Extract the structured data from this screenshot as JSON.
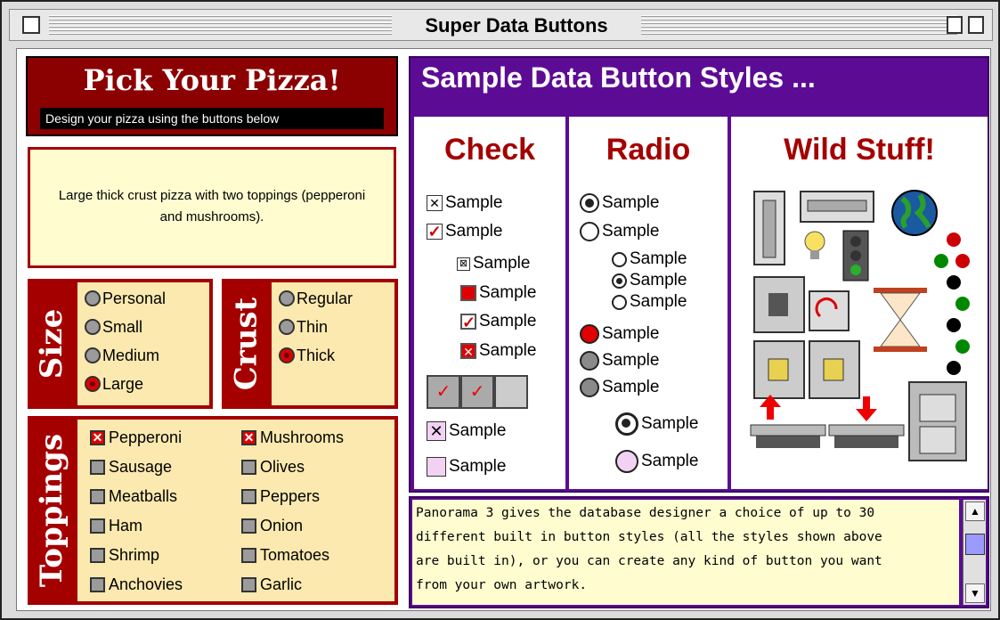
{
  "window": {
    "title": "Super Data Buttons"
  },
  "pizza": {
    "title": "Pick Your Pizza!",
    "subtitle": "Design your pizza using the buttons below",
    "description": "Large thick crust pizza with two toppings (pepperoni and mushrooms).",
    "size": {
      "label": "Size",
      "options": [
        "Personal",
        "Small",
        "Medium",
        "Large"
      ],
      "selected": "Large"
    },
    "crust": {
      "label": "Crust",
      "options": [
        "Regular",
        "Thin",
        "Thick"
      ],
      "selected": "Thick"
    },
    "toppings": {
      "label": "Toppings",
      "left": [
        "Pepperoni",
        "Sausage",
        "Meatballs",
        "Ham",
        "Shrimp",
        "Anchovies"
      ],
      "right": [
        "Mushrooms",
        "Olives",
        "Peppers",
        "Onion",
        "Tomatoes",
        "Garlic"
      ],
      "checked": [
        "Pepperoni",
        "Mushrooms"
      ]
    }
  },
  "samples": {
    "title": "Sample Data Button Styles ...",
    "check_heading": "Check",
    "radio_heading": "Radio",
    "wild_heading": "Wild Stuff!",
    "label": "Sample"
  },
  "info": {
    "lines": [
      "Panorama 3 gives the database designer a choice of up to 30",
      "different built in button styles (all the styles shown above",
      "are built in), or you can create any kind of button you want",
      "from your own artwork."
    ]
  },
  "colors": {
    "accent_red": "#a40000",
    "purple": "#5c0c94",
    "cream": "#fffcd0"
  }
}
